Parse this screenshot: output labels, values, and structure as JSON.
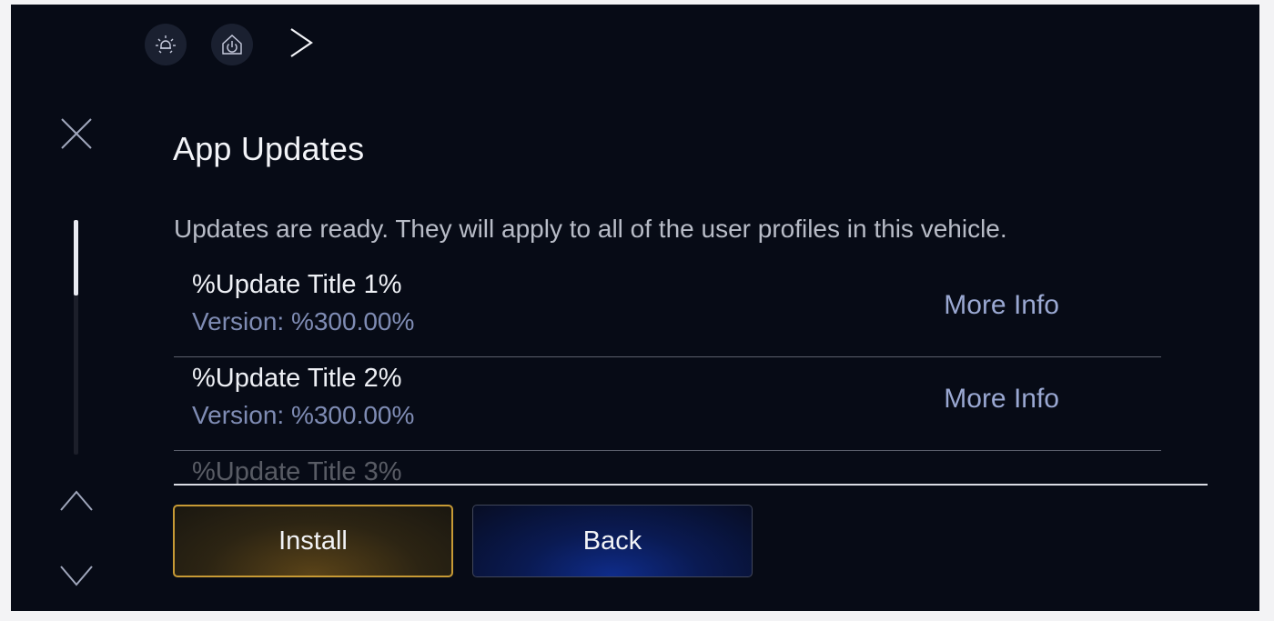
{
  "header": {
    "icons": [
      "brightness-icon",
      "home-power-icon",
      "chevron-right-icon"
    ]
  },
  "page": {
    "title": "App Updates",
    "description": "Updates are ready. They will apply to all of the user profiles in this vehicle."
  },
  "updates": [
    {
      "title": "%Update Title 1%",
      "version": "Version: %300.00%",
      "more_info": "More Info"
    },
    {
      "title": "%Update Title 2%",
      "version": "Version: %300.00%",
      "more_info": "More Info"
    },
    {
      "title": "%Update Title 3%",
      "version": "",
      "more_info": ""
    }
  ],
  "scrollbar": {
    "position_fraction": 0.0,
    "visible_fraction": 0.32
  },
  "actions": {
    "install_label": "Install",
    "back_label": "Back"
  },
  "colors": {
    "background": "#070b16",
    "accent_install": "#c79a35",
    "accent_back": "#0f2c8a",
    "link": "#9aa8d2"
  }
}
